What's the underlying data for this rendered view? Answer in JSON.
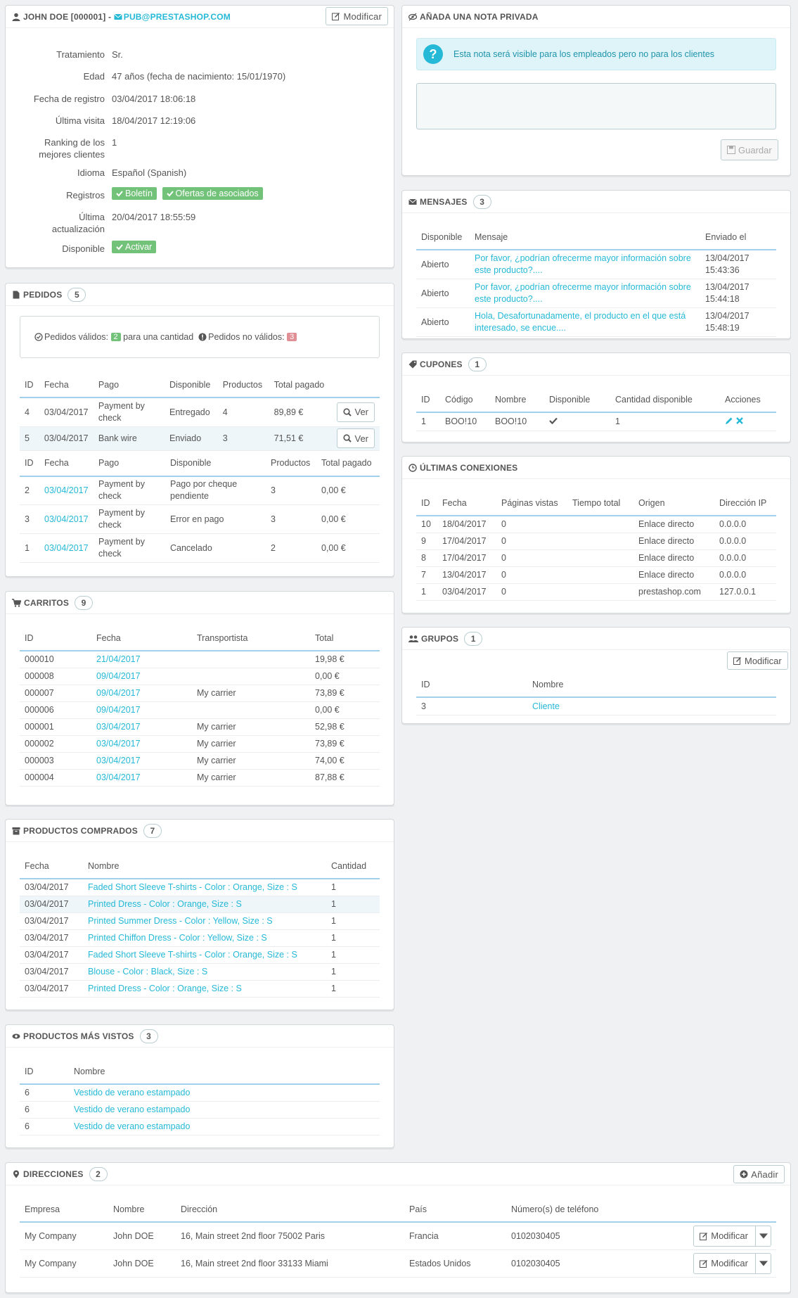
{
  "customer": {
    "title_name": "JOHN DOE [000001] -",
    "email": "PUB@PRESTASHOP.COM",
    "edit_label": "Modificar",
    "fields": [
      {
        "label": "Tratamiento",
        "value": "Sr."
      },
      {
        "label": "Edad",
        "value": "47 años (fecha de nacimiento: 15/01/1970)"
      },
      {
        "label": "Fecha de registro",
        "value": "03/04/2017 18:06:18"
      },
      {
        "label": "Última visita",
        "value": "18/04/2017 12:19:06"
      },
      {
        "label": "Ranking de los mejores clientes",
        "value": "1"
      },
      {
        "label": "Idioma",
        "value": "Español (Spanish)"
      },
      {
        "label": "Registros",
        "tags": [
          "Boletín",
          "Ofertas de asociados"
        ]
      },
      {
        "label": "Última actualización",
        "value": "20/04/2017 18:55:59"
      },
      {
        "label": "Disponible",
        "tags": [
          "Activar"
        ]
      }
    ]
  },
  "note": {
    "title": "AÑADA UNA NOTA PRIVADA",
    "info": "Esta nota será visible para los empleados pero no para los clientes",
    "save_label": "Guardar"
  },
  "messages": {
    "title": "MENSAJES",
    "count": "3",
    "headers": [
      "Disponible",
      "Mensaje",
      "Enviado el"
    ],
    "rows": [
      {
        "status": "Abierto",
        "msg": "Por favor, ¿podrían ofrecerme mayor información sobre este producto?....",
        "date": "13/04/2017",
        "time": "15:43:36"
      },
      {
        "status": "Abierto",
        "msg": "Por favor, ¿podrían ofrecerme mayor información sobre este producto?....",
        "date": "13/04/2017",
        "time": "15:44:18"
      },
      {
        "status": "Abierto",
        "msg": "Hola, Desafortunadamente, el producto en el que está interesado, se encue....",
        "date": "13/04/2017",
        "time": "15:48:19"
      }
    ]
  },
  "orders": {
    "title": "PEDIDOS",
    "count": "5",
    "valid_label": "Pedidos válidos:",
    "valid_count": "2",
    "valid_suffix": "para una cantidad",
    "invalid_label": "Pedidos no válidos:",
    "invalid_count": "3",
    "headers1": [
      "ID",
      "Fecha",
      "Pago",
      "Disponible",
      "Productos",
      "Total pagado"
    ],
    "valid_rows": [
      {
        "id": "4",
        "date": "03/04/2017",
        "pay": "Payment by check",
        "status": "Entregado",
        "products": "4",
        "total": "89,89 €"
      },
      {
        "id": "5",
        "date": "03/04/2017",
        "pay": "Bank wire",
        "status": "Enviado",
        "products": "3",
        "total": "71,51 €"
      }
    ],
    "view_label": "Ver",
    "headers2": [
      "ID",
      "Fecha",
      "Pago",
      "Disponible",
      "Productos",
      "Total pagado"
    ],
    "invalid_rows": [
      {
        "id": "2",
        "date": "03/04/2017",
        "pay": "Payment by check",
        "status": "Pago por cheque pendiente",
        "products": "3",
        "total": "0,00 €"
      },
      {
        "id": "3",
        "date": "03/04/2017",
        "pay": "Payment by check",
        "status": "Error en pago",
        "products": "3",
        "total": "0,00 €"
      },
      {
        "id": "1",
        "date": "03/04/2017",
        "pay": "Payment by check",
        "status": "Cancelado",
        "products": "2",
        "total": "0,00 €"
      }
    ]
  },
  "vouchers": {
    "title": "CUPONES",
    "count": "1",
    "headers": [
      "ID",
      "Código",
      "Nombre",
      "Disponible",
      "Cantidad disponible",
      "Acciones"
    ],
    "rows": [
      {
        "id": "1",
        "code": "BOO!10",
        "name": "BOO!10",
        "qty": "1"
      }
    ]
  },
  "connections": {
    "title": "ÚLTIMAS CONEXIONES",
    "headers": [
      "ID",
      "Fecha",
      "Páginas vistas",
      "Tiempo total",
      "Origen",
      "Dirección IP"
    ],
    "rows": [
      {
        "id": "10",
        "date": "18/04/2017",
        "pages": "0",
        "time": "",
        "origin": "Enlace directo",
        "ip": "0.0.0.0"
      },
      {
        "id": "9",
        "date": "17/04/2017",
        "pages": "0",
        "time": "",
        "origin": "Enlace directo",
        "ip": "0.0.0.0"
      },
      {
        "id": "8",
        "date": "17/04/2017",
        "pages": "0",
        "time": "",
        "origin": "Enlace directo",
        "ip": "0.0.0.0"
      },
      {
        "id": "7",
        "date": "13/04/2017",
        "pages": "0",
        "time": "",
        "origin": "Enlace directo",
        "ip": "0.0.0.0"
      },
      {
        "id": "1",
        "date": "03/04/2017",
        "pages": "0",
        "time": "",
        "origin": "prestashop.com",
        "ip": "127.0.0.1"
      }
    ]
  },
  "groups": {
    "title": "GRUPOS",
    "count": "1",
    "edit_label": "Modificar",
    "headers": [
      "ID",
      "Nombre"
    ],
    "rows": [
      {
        "id": "3",
        "name": "Cliente"
      }
    ]
  },
  "carts": {
    "title": "CARRITOS",
    "count": "9",
    "headers": [
      "ID",
      "Fecha",
      "Transportista",
      "Total"
    ],
    "rows": [
      {
        "id": "000010",
        "date": "21/04/2017",
        "carrier": "",
        "total": "19,98 €"
      },
      {
        "id": "000008",
        "date": "09/04/2017",
        "carrier": "",
        "total": "0,00 €"
      },
      {
        "id": "000007",
        "date": "09/04/2017",
        "carrier": "My carrier",
        "total": "73,89 €"
      },
      {
        "id": "000006",
        "date": "09/04/2017",
        "carrier": "",
        "total": "0,00 €"
      },
      {
        "id": "000001",
        "date": "03/04/2017",
        "carrier": "My carrier",
        "total": "52,98 €"
      },
      {
        "id": "000002",
        "date": "03/04/2017",
        "carrier": "My carrier",
        "total": "73,89 €"
      },
      {
        "id": "000003",
        "date": "03/04/2017",
        "carrier": "My carrier",
        "total": "74,00 €"
      },
      {
        "id": "000004",
        "date": "03/04/2017",
        "carrier": "My carrier",
        "total": "87,88 €"
      }
    ]
  },
  "purchased": {
    "title": "PRODUCTOS COMPRADOS",
    "count": "7",
    "headers": [
      "Fecha",
      "Nombre",
      "Cantidad"
    ],
    "rows": [
      {
        "date": "03/04/2017",
        "name": "Faded Short Sleeve T-shirts - Color : Orange, Size : S",
        "qty": "1"
      },
      {
        "date": "03/04/2017",
        "name": "Printed Dress - Color : Orange, Size : S",
        "qty": "1"
      },
      {
        "date": "03/04/2017",
        "name": "Printed Summer Dress - Color : Yellow, Size : S",
        "qty": "1"
      },
      {
        "date": "03/04/2017",
        "name": "Printed Chiffon Dress - Color : Yellow, Size : S",
        "qty": "1"
      },
      {
        "date": "03/04/2017",
        "name": "Faded Short Sleeve T-shirts - Color : Orange, Size : S",
        "qty": "1"
      },
      {
        "date": "03/04/2017",
        "name": "Blouse - Color : Black, Size : S",
        "qty": "1"
      },
      {
        "date": "03/04/2017",
        "name": "Printed Dress - Color : Orange, Size : S",
        "qty": "1"
      }
    ]
  },
  "viewed": {
    "title": "PRODUCTOS MÁS VISTOS",
    "count": "3",
    "headers": [
      "ID",
      "Nombre"
    ],
    "rows": [
      {
        "id": "6",
        "name": "Vestido de verano estampado"
      },
      {
        "id": "6",
        "name": "Vestido de verano estampado"
      },
      {
        "id": "6",
        "name": "Vestido de verano estampado"
      }
    ]
  },
  "addresses": {
    "title": "DIRECCIONES",
    "count": "2",
    "add_label": "Añadir",
    "edit_label": "Modificar",
    "headers": [
      "Empresa",
      "Nombre",
      "Dirección",
      "País",
      "Número(s) de teléfono"
    ],
    "rows": [
      {
        "company": "My Company",
        "name": "John DOE",
        "address": "16, Main street 2nd floor 75002 Paris",
        "country": "Francia",
        "phone": "0102030405"
      },
      {
        "company": "My Company",
        "name": "John DOE",
        "address": "16, Main street 2nd floor 33133 Miami",
        "country": "Estados Unidos",
        "phone": "0102030405"
      }
    ]
  },
  "colors": {
    "accent": "#25b9d7",
    "success": "#72c279",
    "danger": "#e08f95"
  }
}
